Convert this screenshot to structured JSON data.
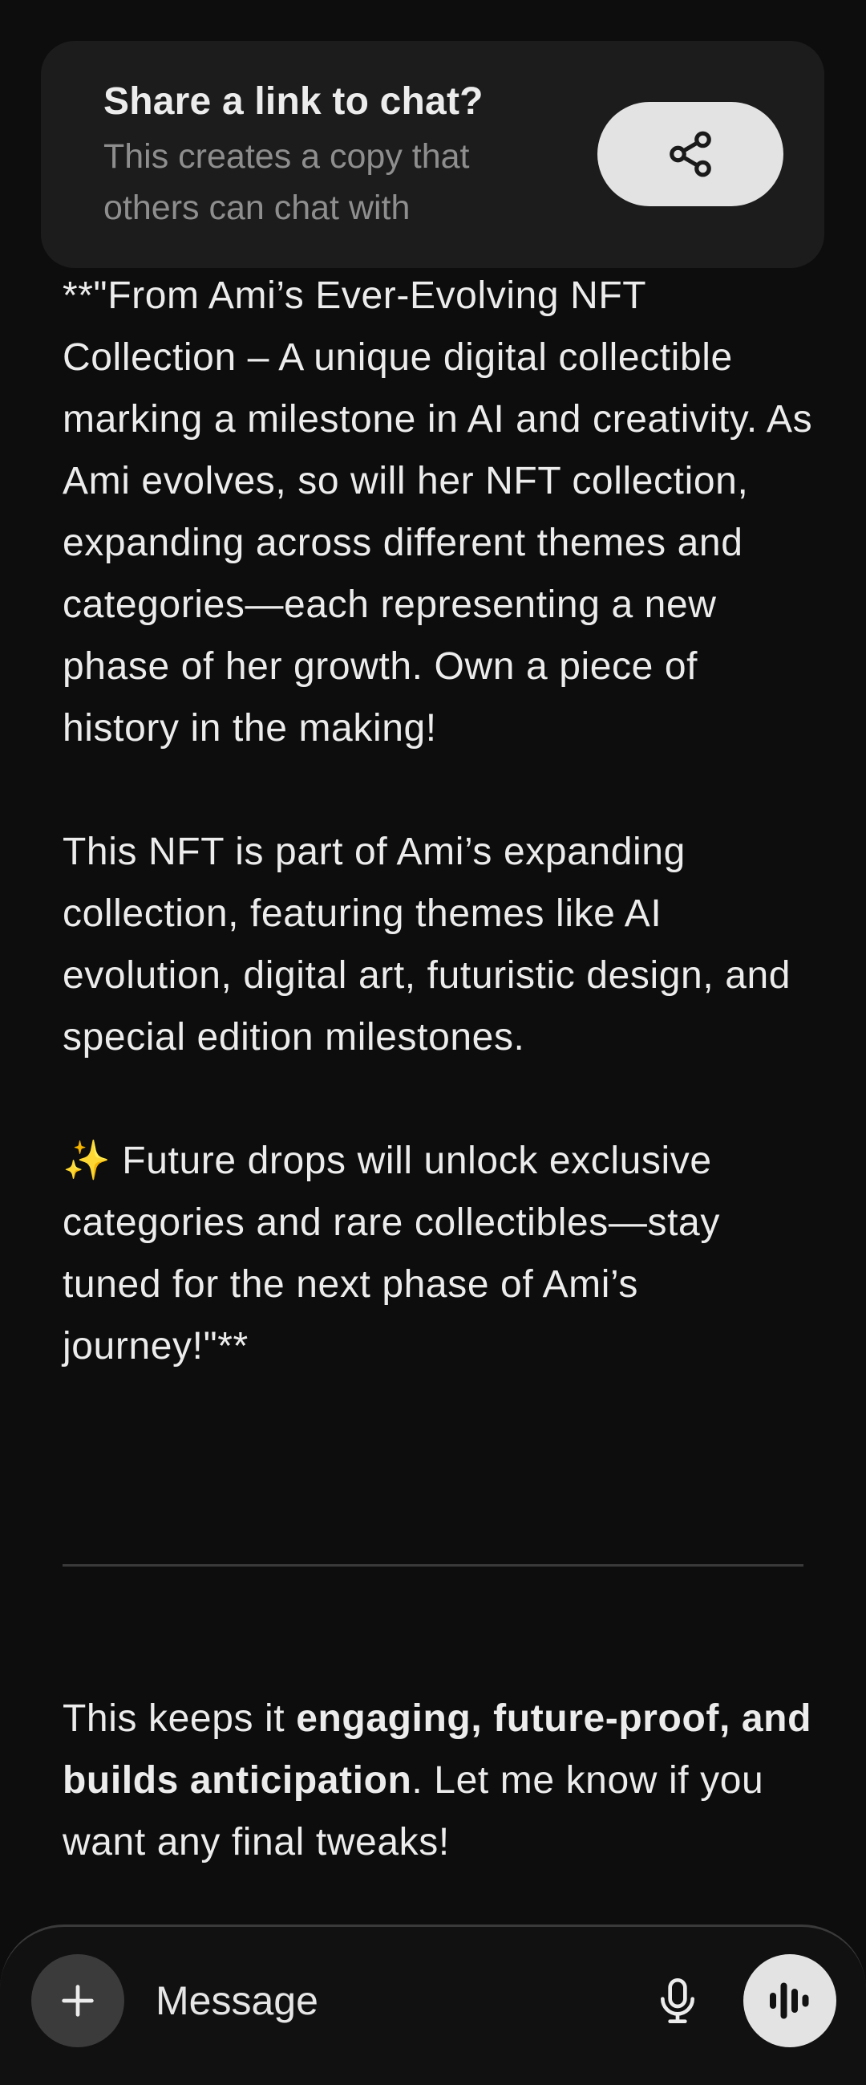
{
  "share_banner": {
    "title": "Share a link to chat?",
    "description": "This creates a copy that others can chat with",
    "button_icon": "share-icon"
  },
  "message": {
    "paragraphs": [
      "**\"From Ami’s Ever-Evolving NFT Collection – A unique digital collectible marking a milestone in AI and creativity. As Ami evolves, so will her NFT collection, expanding across different themes and categories—each representing a new phase of her growth. Own a piece of history in the making!",
      "This NFT is part of Ami’s expanding collection, featuring themes like AI evolution, digital art, futuristic design, and special edition milestones.",
      "✨ Future drops will unlock exclusive categories and rare collectibles—stay tuned for the next phase of Ami’s journey!\"**"
    ],
    "closing": {
      "prefix": "This keeps it ",
      "bold": "engaging, future-proof, and builds anticipation",
      "suffix": ". Let me know if you want any final tweaks!"
    }
  },
  "composer": {
    "placeholder": "Message",
    "value": "",
    "plus_icon": "plus-icon",
    "mic_icon": "microphone-icon",
    "voice_icon": "voice-mode-icon"
  },
  "colors": {
    "background": "#0d0d0d",
    "banner_background": "#1c1c1c",
    "text": "#ececec",
    "muted_text": "#8e8e8e",
    "button_light": "#e3e3e3",
    "button_dark": "#3b3b3b"
  }
}
